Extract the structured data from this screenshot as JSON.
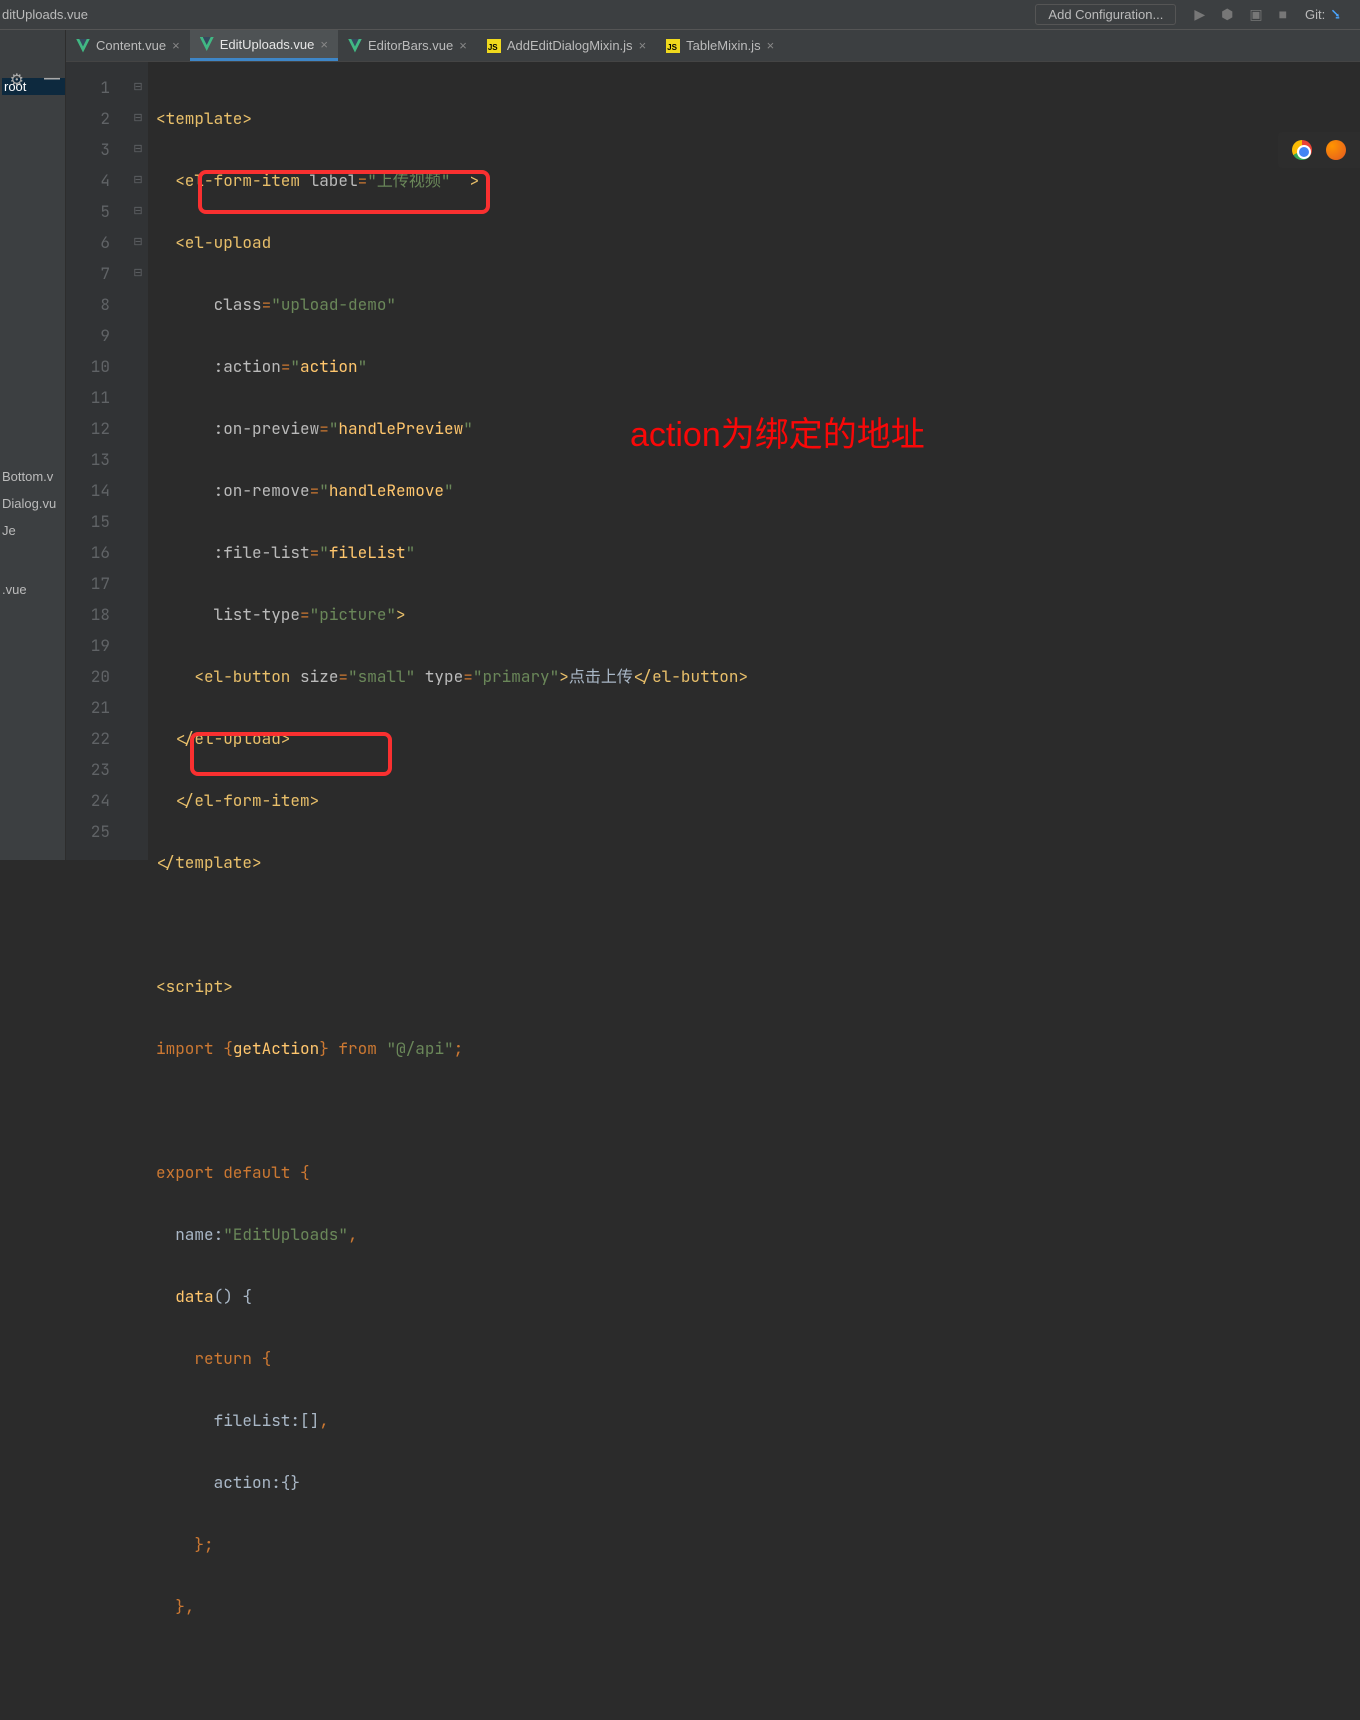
{
  "toolbar": {
    "breadcrumb": "ditUploads.vue",
    "addConfig": "Add Configuration...",
    "gitLabel": "Git:"
  },
  "side": {
    "rootLabel": "root",
    "items": [
      "Bottom.v",
      "Dialog.vu",
      "Je",
      ".vue"
    ]
  },
  "tabs": [
    {
      "label": "Content.vue",
      "type": "vue"
    },
    {
      "label": "EditUploads.vue",
      "type": "vue",
      "active": true
    },
    {
      "label": "EditorBars.vue",
      "type": "vue"
    },
    {
      "label": "AddEditDialogMixin.js",
      "type": "js"
    },
    {
      "label": "TableMixin.js",
      "type": "js"
    }
  ],
  "gutter": [
    "1",
    "2",
    "3",
    "4",
    "5",
    "6",
    "7",
    "8",
    "9",
    "10",
    "11",
    "12",
    "13",
    "14",
    "15",
    "16",
    "17",
    "18",
    "19",
    "20",
    "21",
    "22",
    "23",
    "24",
    "25"
  ],
  "annotation": "action为绑定的地址",
  "code": {
    "l1_a": "<template>",
    "l2_a": "  <el-form-item ",
    "l2_b": "label",
    "l2_c": "=",
    "l2_d": "\"上传视频\"",
    "l2_e": "  >",
    "l3_a": "  <el-upload",
    "l4_a": "      class",
    "l4_b": "=",
    "l4_c": "\"upload-demo\"",
    "l5_a": "      :action",
    "l5_b": "=",
    "l5_c": "\"",
    "l5_d": "action",
    "l5_e": "\"",
    "l6_a": "      :on-preview",
    "l6_b": "=",
    "l6_c": "\"",
    "l6_d": "handlePreview",
    "l6_e": "\"",
    "l7_a": "      :on-remove",
    "l7_b": "=",
    "l7_c": "\"",
    "l7_d": "handleRemove",
    "l7_e": "\"",
    "l8_a": "      :file-list",
    "l8_b": "=",
    "l8_c": "\"",
    "l8_d": "fileList",
    "l8_e": "\"",
    "l9_a": "      list-type",
    "l9_b": "=",
    "l9_c": "\"picture\"",
    "l9_d": ">",
    "l10_a": "    <el-button ",
    "l10_b": "size",
    "l10_c": "=",
    "l10_d": "\"small\"",
    "l10_e": " type",
    "l10_f": "=",
    "l10_g": "\"primary\"",
    "l10_h": ">",
    "l10_i": "点击上传",
    "l10_j": "</el-button>",
    "l11_a": "  </el-upload>",
    "l12_a": "  </el-form-item>",
    "l13_a": "</template>",
    "l15_a": "<script>",
    "l16_a": "import ",
    "l16_b": "{",
    "l16_c": "getAction",
    "l16_d": "}",
    "l16_e": " from ",
    "l16_f": "\"@/api\"",
    "l16_g": ";",
    "l18_a": "export ",
    "l18_b": "default ",
    "l18_c": "{",
    "l19_a": "  name:",
    "l19_b": "\"EditUploads\"",
    "l19_c": ",",
    "l20_a": "  data",
    "l20_b": "() {",
    "l21_a": "    return ",
    "l21_b": "{",
    "l22_a": "      fileList:[]",
    "l22_b": ",",
    "l23_a": "      action:{}",
    "l24_a": "    }",
    "l24_b": ";",
    "l25_a": "  }",
    "l25_b": ","
  }
}
